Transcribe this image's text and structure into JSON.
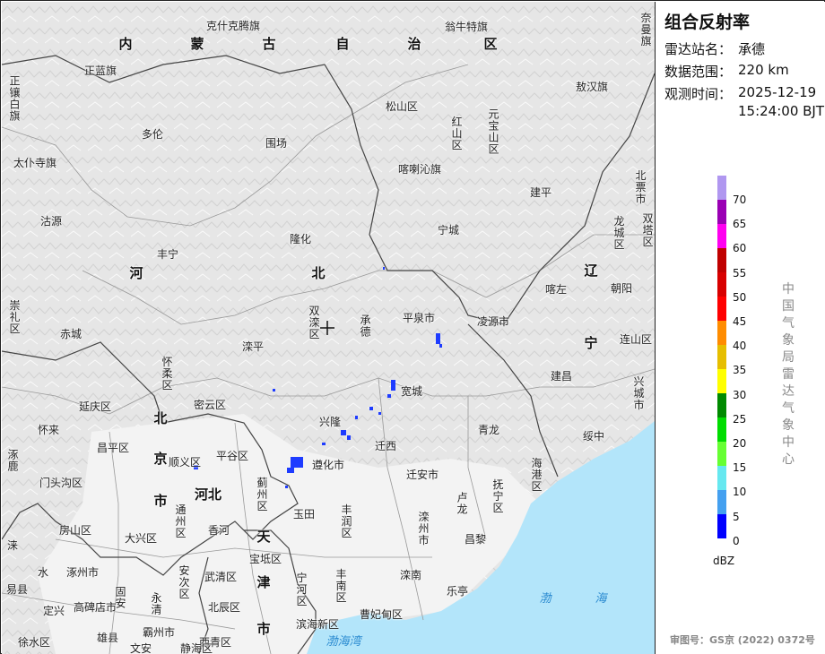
{
  "panel": {
    "title": "组合反射率",
    "station_label": "雷达站名：",
    "station": "承德",
    "range_label": "数据范围：",
    "range": "220 km",
    "time_label": "观测时间：",
    "date": "2025-12-19",
    "time": "15:24:00 BJT",
    "unit": "dBZ",
    "org": "中国气象局雷达气象中心",
    "approval": "审图号：GS京 (2022) 0372号"
  },
  "legend": {
    "colors": [
      "#b097f0",
      "#9a00b4",
      "#ff00f0",
      "#c00000",
      "#d80000",
      "#ff0000",
      "#ff8c00",
      "#e6be00",
      "#ffff00",
      "#008a00",
      "#00dd00",
      "#66ff33",
      "#66e8f0",
      "#44a0f0",
      "#0000ff"
    ],
    "ticks": [
      "70",
      "65",
      "60",
      "55",
      "50",
      "45",
      "40",
      "35",
      "30",
      "25",
      "20",
      "15",
      "10",
      "5",
      "0"
    ]
  },
  "map": {
    "sea_color": "#b3e5fa",
    "echo_color": "#1e3cff",
    "labels": [
      "克什克腾旗",
      "翁牛特旗",
      "奈曼旗",
      "内",
      "蒙",
      "古",
      "自",
      "治",
      "区",
      "正蓝旗",
      "正镶白旗",
      "敖汉旗",
      "松山区",
      "元宝山区",
      "红山区",
      "多伦",
      "围场",
      "太仆寺旗",
      "喀喇沁旗",
      "北票市",
      "建平",
      "沽源",
      "双塔区",
      "龙城区",
      "宁城",
      "隆化",
      "丰宁",
      "河",
      "北",
      "辽",
      "崇礼区",
      "喀左",
      "朝阳",
      "双滦区",
      "承德",
      "平泉市",
      "凌源市",
      "赤城",
      "滦平",
      "怀柔区",
      "宁",
      "连山区",
      "建昌",
      "兴城市",
      "宽城",
      "延庆区",
      "密云区",
      "北",
      "怀来",
      "兴隆",
      "青龙",
      "绥中",
      "迁西",
      "昌平区",
      "涿鹿",
      "京",
      "平谷区",
      "顺义区",
      "遵化市",
      "海港区",
      "门头沟区",
      "蓟州区",
      "迁安市",
      "抚宁区",
      "市",
      "河北",
      "卢龙",
      "通州区",
      "玉田",
      "丰润区",
      "滦州市",
      "香河",
      "天",
      "房山区",
      "大兴区",
      "昌黎",
      "涞",
      "宝坻区",
      "水",
      "涿州市",
      "武清区",
      "安次区",
      "宁河区",
      "丰南区",
      "滦南",
      "津",
      "渤",
      "海",
      "易县",
      "固安",
      "永清",
      "高碑店市",
      "北辰区",
      "曹妃甸区",
      "定兴",
      "滨海新区",
      "市",
      "徐水区",
      "雄县",
      "霸州市",
      "西青区",
      "渤海湾",
      "文安",
      "静海区",
      "乐亭"
    ]
  }
}
